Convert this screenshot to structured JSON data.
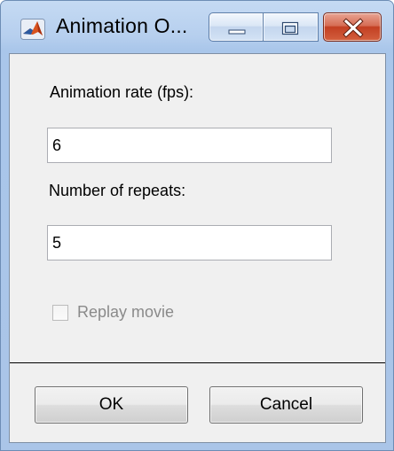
{
  "window": {
    "title": "Animation O...",
    "icon": "matlab-icon",
    "controls": {
      "minimize_icon": "minimize-icon",
      "maximize_icon": "maximize-icon",
      "close_icon": "close-icon"
    }
  },
  "form": {
    "rate_label": "Animation rate (fps):",
    "rate_value": "6",
    "repeats_label": "Number of repeats:",
    "repeats_value": "5",
    "replay_label": "Replay movie",
    "replay_checked": false,
    "replay_enabled": false
  },
  "buttons": {
    "ok_label": "OK",
    "cancel_label": "Cancel"
  },
  "colors": {
    "titlebar": "#b6cfee",
    "close_button": "#c33f22",
    "client_background": "#f0f0f0",
    "disabled_text": "#8a8a8a"
  }
}
